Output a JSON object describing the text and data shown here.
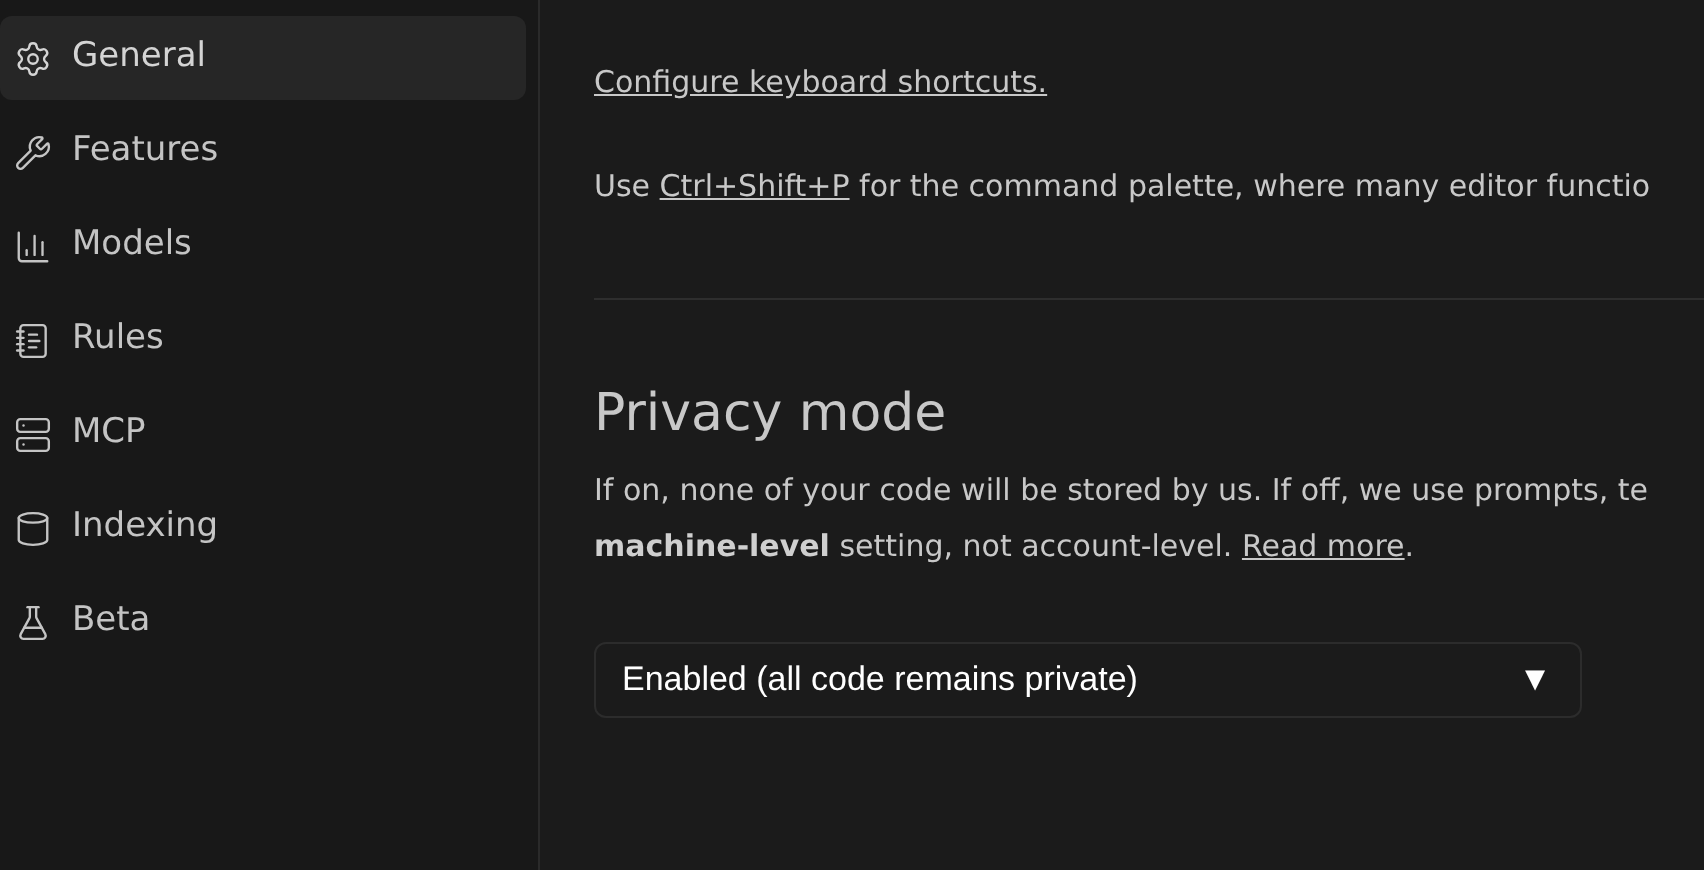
{
  "sidebar": {
    "items": [
      {
        "label": "General",
        "selected": true
      },
      {
        "label": "Features",
        "selected": false
      },
      {
        "label": "Models",
        "selected": false
      },
      {
        "label": "Rules",
        "selected": false
      },
      {
        "label": "MCP",
        "selected": false
      },
      {
        "label": "Indexing",
        "selected": false
      },
      {
        "label": "Beta",
        "selected": false
      }
    ]
  },
  "shortcuts": {
    "link": "Configure keyboard shortcuts.",
    "hint": {
      "prefix": "Use ",
      "link": "Ctrl+Shift+P",
      "suffix": " for the command palette, where many editor functio"
    }
  },
  "privacy": {
    "title": "Privacy mode",
    "lines": [
      "If on, none of your code will be stored by us. If off, we use prompts, te"
    ],
    "last_line": {
      "text": "**machine-level** setting, not account-level. ",
      "link": "Read more",
      "suffix": "."
    },
    "select": {
      "value": "Enabled (all code remains private)",
      "caret": "▼"
    }
  }
}
